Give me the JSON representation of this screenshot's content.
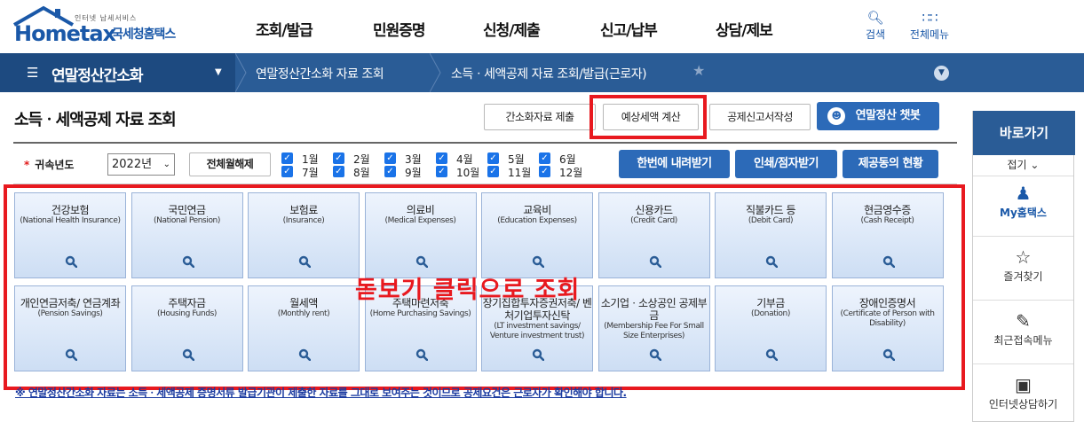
{
  "header": {
    "logo_tagline": "인터넷 납세서비스",
    "logo_main": "Hometax",
    "logo_sub": "국세청홈택스",
    "gnb": [
      "조회/발급",
      "민원증명",
      "신청/제출",
      "신고/납부",
      "상담/제보"
    ],
    "search_label": "검색",
    "allmenu_label": "전체메뉴"
  },
  "nav": {
    "menu_title": "연말정산간소화",
    "crumb1": "연말정산간소화 자료 조회",
    "crumb2": "소득ㆍ세액공제 자료 조회/발급(근로자)"
  },
  "page": {
    "title": "소득ㆍ세액공제 자료 조회",
    "btn_submit": "간소화자료 제출",
    "btn_estimate": "예상세액 계산",
    "btn_form": "공제신고서작성",
    "btn_chatbot": "연말정산 챗봇",
    "filter_label": "귀속년도",
    "year_value": "2022년",
    "btn_deselect_all": "전체월해제",
    "months": [
      "1월",
      "2월",
      "3월",
      "4월",
      "5월",
      "6월",
      "7월",
      "8월",
      "9월",
      "10월",
      "11월",
      "12월"
    ],
    "btn_download_all": "한번에 내려받기",
    "btn_print": "인쇄/점자받기",
    "btn_status": "제공동의 현황",
    "overlay_note": "돋보기 클릭으로 조회",
    "notice": "※ 연말정산간소화 자료는 소득ㆍ세액공제 증명서류 발급기관이 제출한 자료를 그대로 보여주는 것이므로 공제요건은 근로자가 확인해야 합니다."
  },
  "cards": [
    {
      "ko": "건강보험",
      "en": "(National Health Insurance)"
    },
    {
      "ko": "국민연금",
      "en": "(National Pension)"
    },
    {
      "ko": "보험료",
      "en": "(Insurance)"
    },
    {
      "ko": "의료비",
      "en": "(Medical Expenses)"
    },
    {
      "ko": "교육비",
      "en": "(Education Expenses)"
    },
    {
      "ko": "신용카드",
      "en": "(Credit Card)"
    },
    {
      "ko": "직불카드 등",
      "en": "(Debit Card)"
    },
    {
      "ko": "현금영수증",
      "en": "(Cash Receipt)"
    },
    {
      "ko": "개인연금저축/ 연금계좌",
      "en": "(Pension Savings)"
    },
    {
      "ko": "주택자금",
      "en": "(Housing Funds)"
    },
    {
      "ko": "월세액",
      "en": "(Monthly rent)"
    },
    {
      "ko": "주택마련저축",
      "en": "(Home Purchasing Savings)"
    },
    {
      "ko": "장기집합투자증권저축/ 벤처기업투자신탁",
      "en": "(LT investment savings/ Venture investment trust)"
    },
    {
      "ko": "소기업ㆍ소상공인 공제부금",
      "en": "(Membership Fee For Small Size Enterprises)"
    },
    {
      "ko": "기부금",
      "en": "(Donation)"
    },
    {
      "ko": "장애인증명서",
      "en": "(Certificate of Person with Disability)"
    }
  ],
  "sidebar": {
    "title": "바로가기",
    "fold": "접기",
    "items": [
      "My홈택스",
      "즐겨찾기",
      "최근접속메뉴",
      "인터넷상담하기"
    ]
  },
  "colors": {
    "brand": "#2a5c96",
    "accent": "#2c6ab8",
    "highlight": "#e8191f"
  }
}
